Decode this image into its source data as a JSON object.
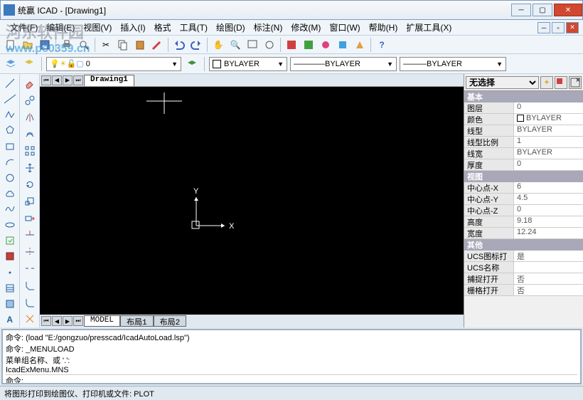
{
  "title": "统赢 ICAD - [Drawing1]",
  "menu": [
    "文件(F)",
    "编辑(E)",
    "视图(V)",
    "插入(I)",
    "格式",
    "工具(T)",
    "绘图(D)",
    "标注(N)",
    "修改(M)",
    "窗口(W)",
    "帮助(H)",
    "扩展工具(X)"
  ],
  "layer_combo": "0",
  "color_combo": "BYLAYER",
  "linetype_combo": "BYLAYER",
  "lineweight_combo": "BYLAYER",
  "doc_tab": "Drawing1",
  "bottom_tabs": [
    "MODEL",
    "布局1",
    "布局2"
  ],
  "props": {
    "selector": "无选择",
    "groups": [
      {
        "name": "基本",
        "rows": [
          {
            "k": "图层",
            "v": "0"
          },
          {
            "k": "颜色",
            "v": "BYLAYER",
            "swatch": true
          },
          {
            "k": "线型",
            "v": "BYLAYER"
          },
          {
            "k": "线型比例",
            "v": "1"
          },
          {
            "k": "线宽",
            "v": "BYLAYER"
          },
          {
            "k": "厚度",
            "v": "0"
          }
        ]
      },
      {
        "name": "视图",
        "rows": [
          {
            "k": "中心点-X",
            "v": "6"
          },
          {
            "k": "中心点-Y",
            "v": "4.5"
          },
          {
            "k": "中心点-Z",
            "v": "0"
          },
          {
            "k": "高度",
            "v": "9.18"
          },
          {
            "k": "宽度",
            "v": "12.24"
          }
        ]
      },
      {
        "name": "其他",
        "rows": [
          {
            "k": "UCS图标打开",
            "v": "是"
          },
          {
            "k": "UCS名称",
            "v": ""
          },
          {
            "k": "捕捉打开",
            "v": "否"
          },
          {
            "k": "栅格打开",
            "v": "否"
          }
        ]
      }
    ]
  },
  "cmd_lines": [
    "命令: (load \"E:/gongzuo/presscad/IcadAutoLoad.lsp\")",
    "命令: _MENULOAD",
    "菜单组名称、或 '.':",
    "IcadExMenu.MNS"
  ],
  "cmd_prompt": "命令:",
  "status": "将图形打印到绘图仪、打印机或文件: PLOT",
  "watermark_cn": "河东软件园",
  "watermark_url": "www.pc0359.cn",
  "axis_x": "X",
  "axis_y": "Y"
}
